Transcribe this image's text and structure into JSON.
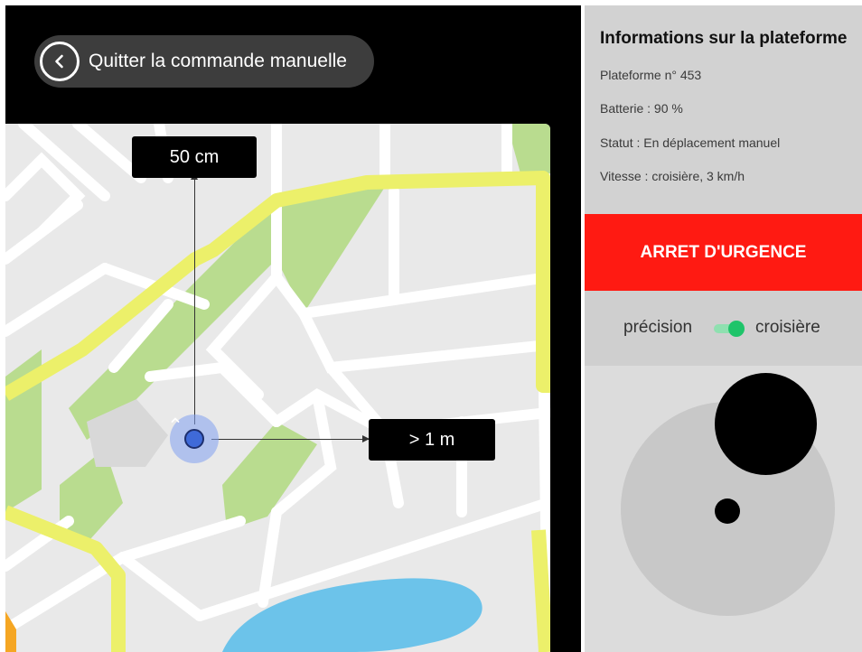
{
  "header": {
    "quit_label": "Quitter la commande manuelle",
    "quit_icon": "chevron-left-icon"
  },
  "map": {
    "vertical_distance": "50 cm",
    "horizontal_distance": "> 1 m",
    "marker_icon": "chevron-up-icon",
    "colors": {
      "background": "#e9e9e9",
      "roads": "#ffffff",
      "main_road": "#ecf06a",
      "parks": "#b9dc8f",
      "water": "#6cc3ea",
      "position": "#3f6ad8"
    }
  },
  "info": {
    "title": "Informations sur la plateforme",
    "platform": "Plateforme n° 453",
    "battery": "Batterie : 90 %",
    "status": "Statut : En déplacement manuel",
    "speed": "Vitesse : croisière, 3 km/h"
  },
  "emergency": {
    "label": "ARRET D'URGENCE",
    "color": "#ff1a12"
  },
  "mode": {
    "left_label": "précision",
    "right_label": "croisière",
    "selected": "croisière",
    "toggle_color": "#1fc46a"
  }
}
